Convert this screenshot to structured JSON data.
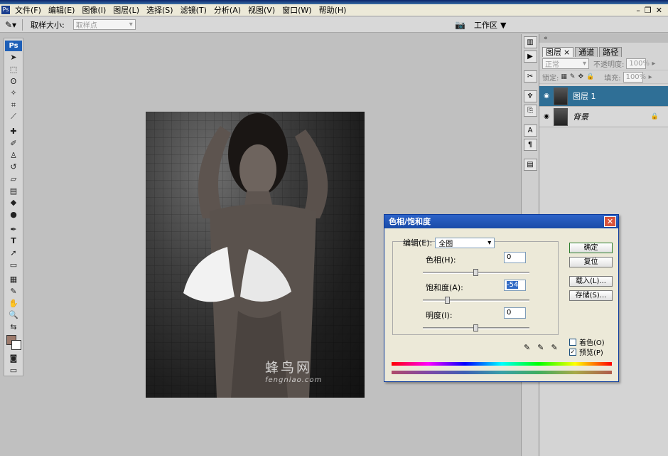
{
  "menubar": {
    "items": [
      "文件(F)",
      "编辑(E)",
      "图像(I)",
      "图层(L)",
      "选择(S)",
      "滤镜(T)",
      "分析(A)",
      "视图(V)",
      "窗口(W)",
      "帮助(H)"
    ]
  },
  "options_bar": {
    "sample_size_label": "取样大小:",
    "sample_size_value": "取样点",
    "workspace_label": "工作区"
  },
  "toolbox": {
    "badge": "Ps",
    "foreground_color": "#9c7a6c",
    "background_color": "#ffffff"
  },
  "canvas": {
    "watermark_text": "蜂鸟网",
    "watermark_url": "fengniao.com"
  },
  "layers_panel": {
    "tabs": [
      "图层",
      "通道",
      "路径"
    ],
    "blend_mode": "正常",
    "opacity_label": "不透明度:",
    "opacity_value": "100%",
    "lock_label": "锁定:",
    "fill_label": "填充:",
    "fill_value": "100%",
    "layers": [
      {
        "name": "图层 1",
        "selected": true
      },
      {
        "name": "背景",
        "selected": false,
        "locked": true
      }
    ]
  },
  "dialog": {
    "title": "色相/饱和度",
    "edit_label": "编辑(E):",
    "edit_value": "全图",
    "hue_label": "色相(H):",
    "hue_value": "0",
    "saturation_label": "饱和度(A):",
    "saturation_value": "-54",
    "lightness_label": "明度(I):",
    "lightness_value": "0",
    "ok_label": "确定",
    "reset_label": "复位",
    "load_label": "载入(L)...",
    "save_label": "存储(S)...",
    "colorize_label": "着色(O)",
    "colorize_checked": false,
    "preview_label": "预览(P)",
    "preview_checked": true
  }
}
